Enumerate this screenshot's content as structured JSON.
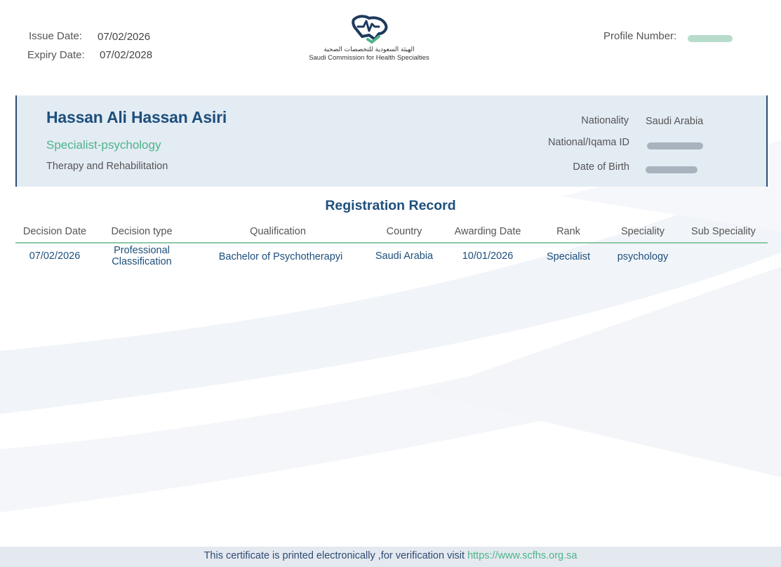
{
  "header": {
    "issue_label": "Issue Date:",
    "issue_value": "07/02/2026",
    "expiry_label": "Expiry Date:",
    "expiry_value": "07/02/2028",
    "profile_label": "Profile Number:",
    "logo_text_ar": "الهيئة السعودية للتخصصات الصحية",
    "logo_text_en": "Saudi Commission for Health Specialties"
  },
  "person": {
    "name": "Hassan Ali Hassan Asiri",
    "title": "Specialist-psychology",
    "department": "Therapy and Rehabilitation",
    "nationality_label": "Nationality",
    "nationality_value": "Saudi Arabia",
    "national_id_label": "National/Iqama ID",
    "dob_label": "Date of Birth"
  },
  "registration": {
    "title": "Registration Record",
    "columns": [
      "Decision Date",
      "Decision type",
      "Qualification",
      "Country",
      "Awarding Date",
      "Rank",
      "Speciality",
      "Sub Speciality"
    ],
    "rows": [
      {
        "decision_date": "07/02/2026",
        "decision_type_line1": "Professional",
        "decision_type_line2": "Classification",
        "qualification": "Bachelor of Psychotherapyi",
        "country": "Saudi Arabia",
        "awarding_date": "10/01/2026",
        "rank": "Specialist",
        "speciality": "psychology",
        "sub_speciality": ""
      }
    ]
  },
  "footer": {
    "text": "This certificate is printed electronically ,for verification visit ",
    "link": "https://www.scfhs.org.sa"
  },
  "colors": {
    "navy": "#1d4f7c",
    "green": "#4db48a",
    "banner": "#e3ebf3"
  }
}
